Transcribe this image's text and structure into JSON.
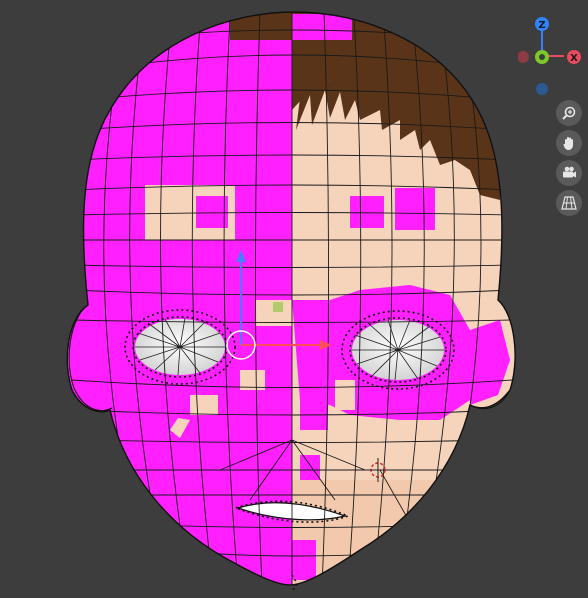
{
  "viewport": {
    "gizmo": {
      "z_label": "Z",
      "x_label": "X",
      "colors": {
        "z": "#2f83ff",
        "y": "#7ec72a",
        "x": "#e84a5f",
        "neg_x": "#8d3b44",
        "neg_z": "#2b5a91"
      }
    },
    "nav_tools": [
      {
        "icon": "zoom-icon"
      },
      {
        "icon": "hand-pan-icon"
      },
      {
        "icon": "camera-icon"
      },
      {
        "icon": "grid-perspective-icon"
      }
    ],
    "mesh_colors": {
      "magenta": "#ff1fff",
      "skin": "#f6d3bb",
      "hair": "#5a3418",
      "eye_white": "#f7f7f7"
    }
  }
}
